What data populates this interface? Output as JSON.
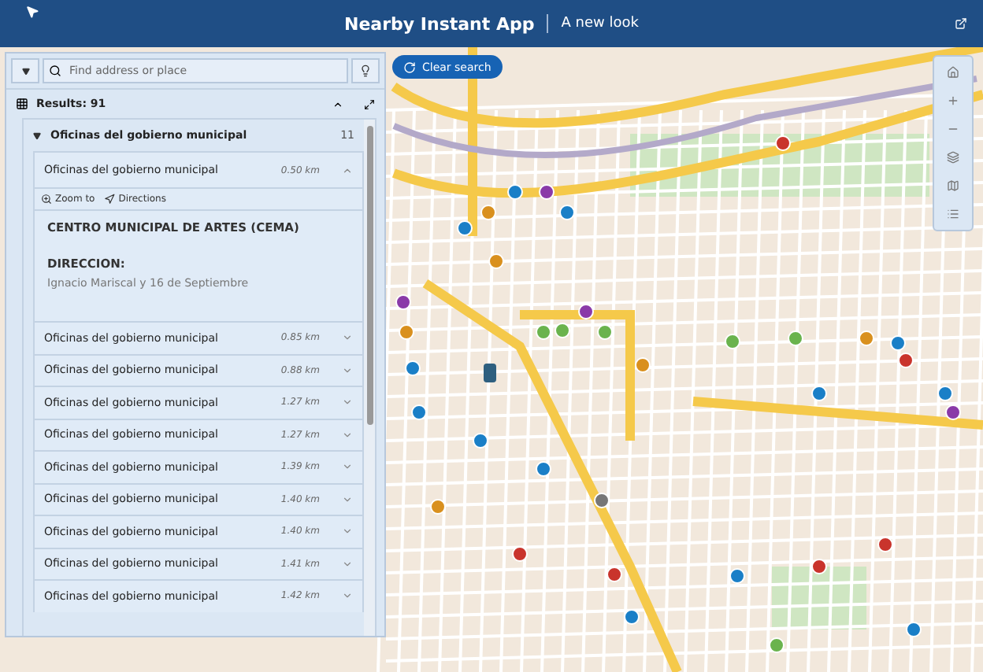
{
  "header": {
    "title": "Nearby Instant App",
    "subtitle": "A new look"
  },
  "search": {
    "placeholder": "Find address or place"
  },
  "clear_button": {
    "label": "Clear search"
  },
  "results": {
    "label": "Results: 91",
    "expanded": true
  },
  "group": {
    "name": "Oficinas del gobierno municipal",
    "count": "11",
    "expanded": true
  },
  "items": [
    {
      "name": "Oficinas del gobierno municipal",
      "distance": "0.50 km",
      "expanded": true,
      "actions": [
        "Zoom to",
        "Directions"
      ],
      "title": "CENTRO MUNICIPAL DE ARTES (CEMA)",
      "field_label": "DIRECCION:",
      "field_value": "Ignacio Mariscal y 16 de Septiembre"
    },
    {
      "name": "Oficinas del gobierno municipal",
      "distance": "0.85 km",
      "expanded": false
    },
    {
      "name": "Oficinas del gobierno municipal",
      "distance": "0.88 km",
      "expanded": false
    },
    {
      "name": "Oficinas del gobierno municipal",
      "distance": "1.27 km",
      "expanded": false
    },
    {
      "name": "Oficinas del gobierno municipal",
      "distance": "1.27 km",
      "expanded": false
    },
    {
      "name": "Oficinas del gobierno municipal",
      "distance": "1.39 km",
      "expanded": false
    },
    {
      "name": "Oficinas del gobierno municipal",
      "distance": "1.40 km",
      "expanded": false
    },
    {
      "name": "Oficinas del gobierno municipal",
      "distance": "1.40 km",
      "expanded": false
    },
    {
      "name": "Oficinas del gobierno municipal",
      "distance": "1.41 km",
      "expanded": false
    },
    {
      "name": "Oficinas del gobierno municipal",
      "distance": "1.42 km",
      "expanded": false
    }
  ]
}
